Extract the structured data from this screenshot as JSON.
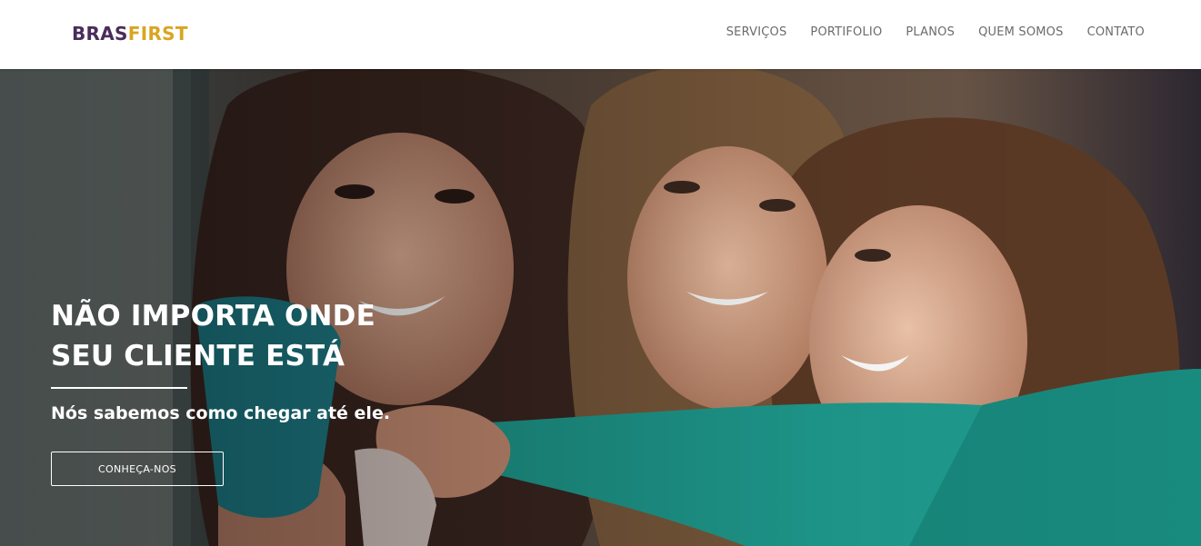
{
  "header": {
    "logo": {
      "part1": "BRAS",
      "part2": "FIRST"
    },
    "nav": [
      {
        "label": "SERVIÇOS"
      },
      {
        "label": "PORTIFOLIO"
      },
      {
        "label": "PLANOS"
      },
      {
        "label": "QUEM SOMOS"
      },
      {
        "label": "CONTATO"
      }
    ]
  },
  "hero": {
    "headline_line1": "NÃO IMPORTA ONDE",
    "headline_line2": "SEU CLIENTE ESTÁ",
    "subheadline": "Nós sabemos como chegar até ele.",
    "cta_label": "CONHEÇA-NOS"
  },
  "colors": {
    "brand_dark": "#4a2c5a",
    "brand_accent": "#d9a521",
    "nav_text": "#6b6b6b",
    "hero_text": "#ffffff"
  }
}
